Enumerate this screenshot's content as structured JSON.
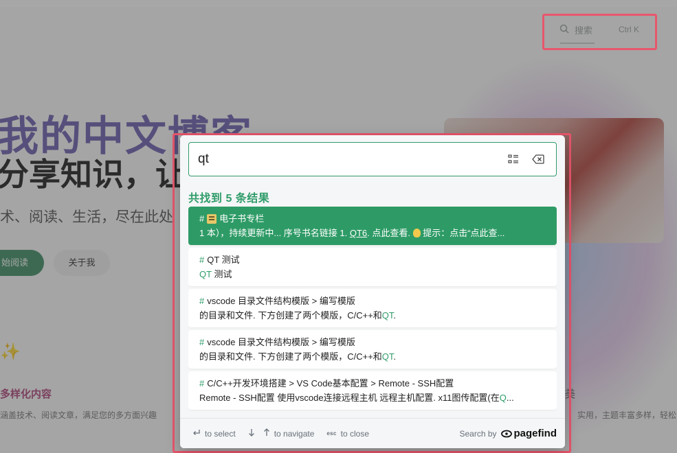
{
  "background": {
    "search_label": "搜索",
    "search_shortcut": "Ctrl K",
    "title_line1": "我的中文博客",
    "title_line2": "分享知识，让",
    "subtitle": "术、阅读、生活，尽在此处",
    "read_button": "始阅读",
    "about_button": "关于我",
    "sparkle": "✨",
    "feature_title": "多样化内容",
    "feature_text": "涵盖技术、阅读文章，满足您的多方面兴趣",
    "feature_text_right": "实用，主题丰富多样，轻松",
    "feature_title_right": "美"
  },
  "search": {
    "query": "qt",
    "result_count": "共找到 5 条结果",
    "colors": {
      "accent": "#2f9c6a",
      "highlight_border": "#e8566c"
    }
  },
  "results": [
    {
      "title_prefix": "#",
      "title": "电子书专栏",
      "icon": "book-icon",
      "excerpt_a": "1 本），持续更新中... 序号书名链接 1. ",
      "excerpt_mark": "QT6",
      "excerpt_b": ". 点此查看. ",
      "excerpt_c": " 提示：点击“点此查...",
      "selected": true
    },
    {
      "title_prefix": "#",
      "title": "QT 测试",
      "excerpt_a": "",
      "excerpt_mark": "QT",
      "excerpt_b": " 测试",
      "selected": false
    },
    {
      "title_prefix": "#",
      "title": "vscode 目录文件结构模版 > 编写模版",
      "excerpt_a": "的目录和文件. 下方创建了两个模版，C/C++和",
      "excerpt_mark": "QT",
      "excerpt_b": ".",
      "selected": false
    },
    {
      "title_prefix": "#",
      "title": "vscode 目录文件结构模版 > 编写模版",
      "excerpt_a": "的目录和文件. 下方创建了两个模版，C/C++和",
      "excerpt_mark": "QT",
      "excerpt_b": ".",
      "selected": false
    },
    {
      "title_prefix": "#",
      "title": "C/C++开发环境搭建 > VS Code基本配置 > Remote - SSH配置",
      "excerpt_a": "Remote - SSH配置 使用vscode连接远程主机 远程主机配置. x11图传配置(在",
      "excerpt_mark": "Q",
      "excerpt_b": "...",
      "selected": false
    }
  ],
  "footer": {
    "select_label": "to select",
    "navigate_label": "to navigate",
    "esc_key": "esc",
    "close_label": "to close",
    "search_by": "Search by",
    "brand": "pagefind"
  }
}
